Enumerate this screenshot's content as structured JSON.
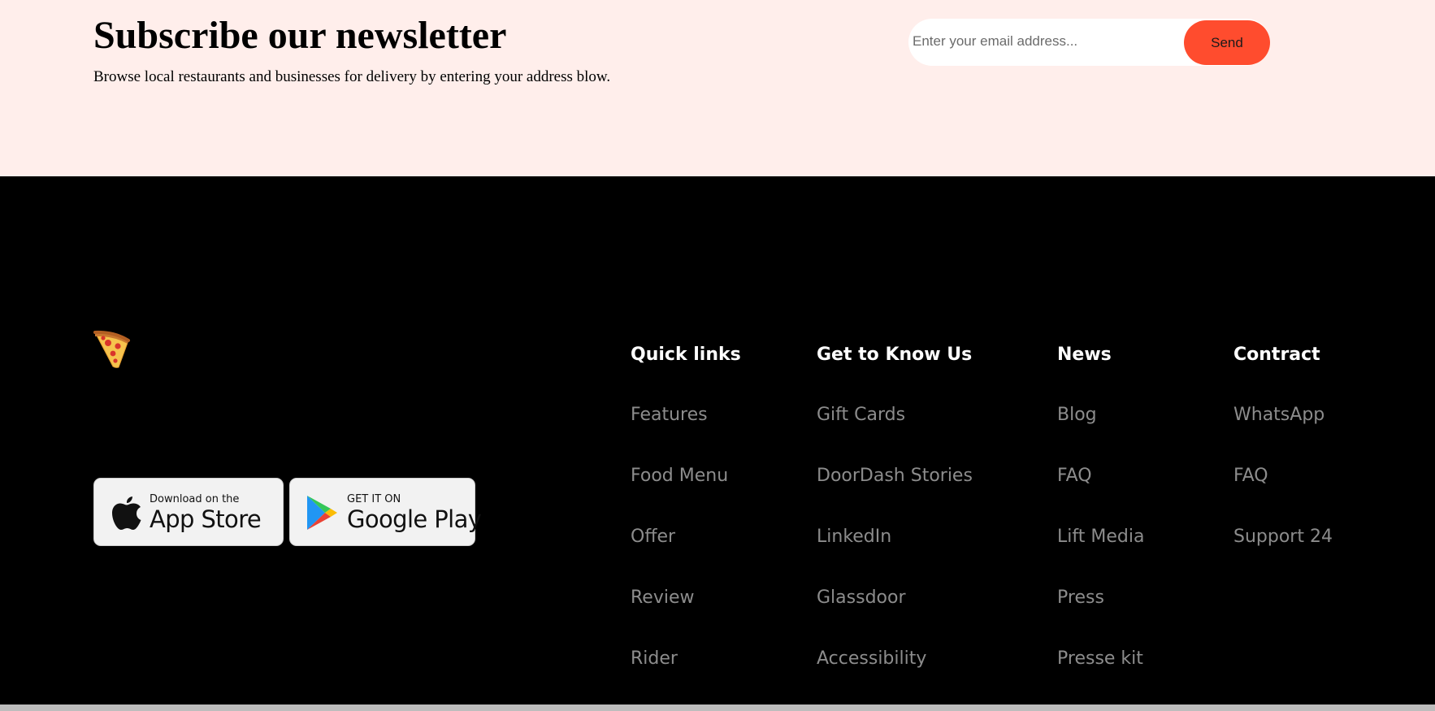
{
  "newsletter": {
    "title": "Subscribe our newsletter",
    "subtitle": "Browse local restaurants and businesses for delivery by entering your address blow.",
    "email_placeholder": "Enter your email address...",
    "send_label": "Send"
  },
  "footer": {
    "logo_icon": "pizza-slice-icon",
    "app_store": {
      "small": "Download on the",
      "big": "App Store",
      "icon": "apple-icon"
    },
    "google_play": {
      "small": "GET IT ON",
      "big": "Google Play",
      "icon": "google-play-icon"
    },
    "columns": [
      {
        "title": "Quick links",
        "links": [
          "Features",
          "Food Menu",
          "Offer",
          "Review",
          "Rider"
        ]
      },
      {
        "title": "Get to Know Us",
        "links": [
          "Gift Cards",
          "DoorDash Stories",
          "LinkedIn",
          "Glassdoor",
          "Accessibility"
        ]
      },
      {
        "title": "News",
        "links": [
          "Blog",
          "FAQ",
          "Lift Media",
          "Press",
          "Presse kit"
        ]
      },
      {
        "title": "Contract",
        "links": [
          "WhatsApp",
          "FAQ",
          "Support 24"
        ]
      }
    ]
  },
  "colors": {
    "newsletter_bg": "#FFEEEB",
    "accent": "#FF4C2E",
    "footer_bg": "#000000",
    "footer_link": "#8C8C8C"
  }
}
